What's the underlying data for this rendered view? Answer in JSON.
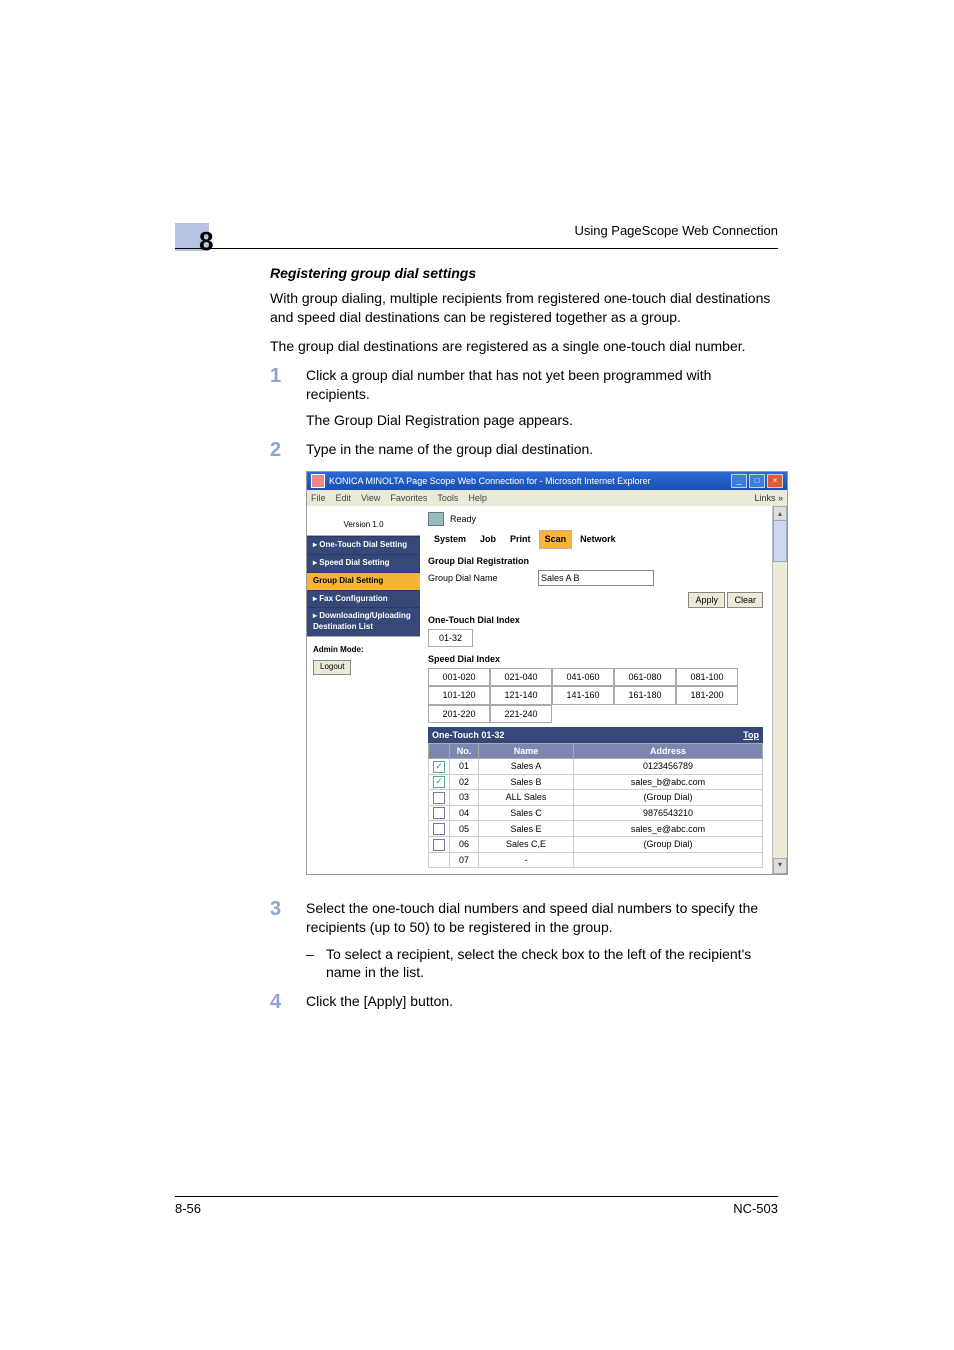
{
  "header": {
    "chapter_number": "8",
    "running_head": "Using PageScope Web Connection"
  },
  "section": {
    "subheading": "Registering group dial settings",
    "intro_p1": "With group dialing, multiple recipients from registered one-touch dial destinations and speed dial destinations can be registered together as a group.",
    "intro_p2": "The group dial destinations are registered as a single one-touch dial number."
  },
  "steps": {
    "s1_num": "1",
    "s1_body": "Click a group dial number that has not yet been programmed with recipients.",
    "s1_sub": "The Group Dial Registration page appears.",
    "s2_num": "2",
    "s2_body": "Type in the name of the group dial destination.",
    "s3_num": "3",
    "s3_body": "Select the one-touch dial numbers and speed dial numbers to specify the recipients (up to 50) to be registered in the group.",
    "s3_dash": "To select a recipient, select the check box to the left of the recipient's name in the list.",
    "s4_num": "4",
    "s4_body": "Click the [Apply] button."
  },
  "screenshot": {
    "window_title": "KONICA MINOLTA Page Scope Web Connection for      - Microsoft Internet Explorer",
    "menu": {
      "file": "File",
      "edit": "Edit",
      "view": "View",
      "fav": "Favorites",
      "tools": "Tools",
      "help": "Help",
      "links": "Links"
    },
    "status": "Ready",
    "version": "Version 1.0",
    "tabs": {
      "system": "System",
      "job": "Job",
      "print": "Print",
      "scan": "Scan",
      "network": "Network"
    },
    "sidenav": {
      "onetouch": "One-Touch Dial Setting",
      "speed": "Speed Dial Setting",
      "group": "Group Dial Setting",
      "fax": "Fax Configuration",
      "dl": "Downloading/Uploading Destination List"
    },
    "admin_label": "Admin Mode:",
    "logout": "Logout",
    "group_reg_title": "Group Dial Registration",
    "group_name_label": "Group Dial Name",
    "group_name_value": "Sales A B",
    "apply": "Apply",
    "clear": "Clear",
    "onetouch_index_title": "One-Touch Dial Index",
    "onetouch_index_val": "01-32",
    "speed_index_title": "Speed Dial Index",
    "speed_ranges": [
      "001-020",
      "021-040",
      "041-060",
      "061-080",
      "081-100",
      "101-120",
      "121-140",
      "141-160",
      "161-180",
      "181-200",
      "201-220",
      "221-240"
    ],
    "onetouch_header": "One-Touch 01-32",
    "top": "Top",
    "table": {
      "col_no": "No.",
      "col_name": "Name",
      "col_addr": "Address",
      "rows": [
        {
          "checked": true,
          "no": "01",
          "name": "Sales A",
          "addr": "0123456789"
        },
        {
          "checked": true,
          "no": "02",
          "name": "Sales B",
          "addr": "sales_b@abc.com"
        },
        {
          "checked": false,
          "no": "03",
          "name": "ALL Sales",
          "addr": "(Group Dial)"
        },
        {
          "checked": false,
          "no": "04",
          "name": "Sales C",
          "addr": "9876543210"
        },
        {
          "checked": false,
          "no": "05",
          "name": "Sales E",
          "addr": "sales_e@abc.com"
        },
        {
          "checked": false,
          "no": "06",
          "name": "Sales C,E",
          "addr": "(Group Dial)"
        },
        {
          "checked": false,
          "no": "07",
          "name": "-",
          "addr": ""
        }
      ]
    }
  },
  "footer": {
    "page": "8-56",
    "model": "NC-503"
  }
}
